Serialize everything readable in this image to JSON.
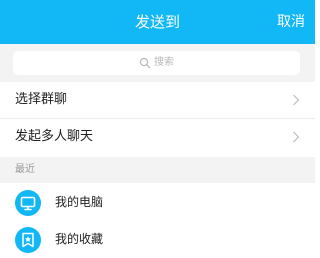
{
  "header": {
    "title": "发送到",
    "cancel_label": "取消",
    "background_color": "#12b7f5"
  },
  "search": {
    "placeholder": "搜索",
    "icon": "search-icon"
  },
  "menu": {
    "select_group": "选择群聊",
    "start_multi_chat": "发起多人聊天"
  },
  "recent": {
    "section_label": "最近",
    "items": [
      {
        "label": "我的电脑",
        "icon": "computer-icon"
      },
      {
        "label": "我的收藏",
        "icon": "favorites-star-icon"
      }
    ]
  }
}
